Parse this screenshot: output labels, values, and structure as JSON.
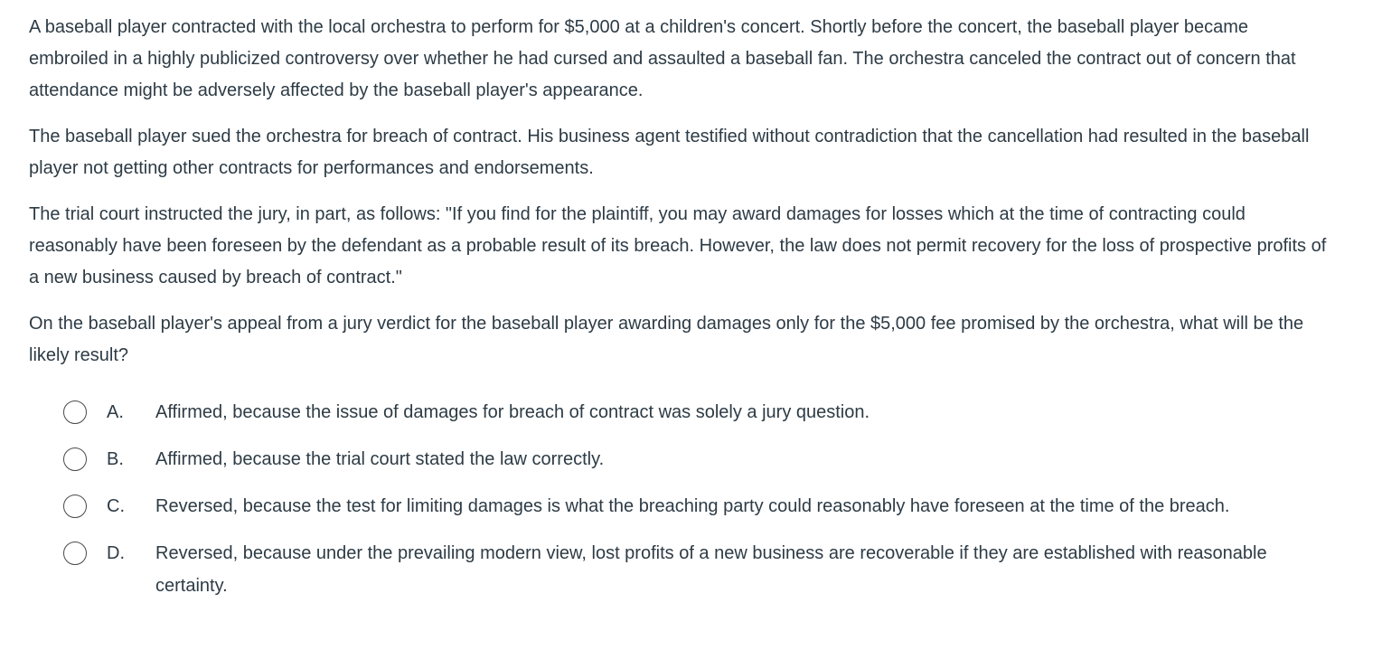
{
  "question": {
    "paragraphs": [
      "A baseball player contracted with the local orchestra to perform for $5,000 at a children's concert.  Shortly before the concert, the baseball player became embroiled in a highly publicized controversy over whether he had cursed and assaulted a baseball fan.  The orchestra canceled the contract out of concern that attendance might be adversely affected by the baseball player's appearance.",
      "The baseball player sued the orchestra for breach of contract.  His business agent testified without contradiction that the cancellation had resulted in the baseball player not getting other contracts for performances and endorsements.",
      "The trial court instructed the jury, in part, as follows: \"If you find for the plaintiff, you may award damages for losses which at the time of contracting could reasonably have been foreseen by the defendant as a probable result of its breach.  However, the law does not permit recovery for the loss of prospective profits of a new business caused by breach of contract.\"",
      "On the baseball player's appeal from a jury verdict for the baseball player awarding damages only for the $5,000 fee promised by the orchestra, what will be the likely result?"
    ]
  },
  "answers": [
    {
      "letter": "A.",
      "text": "Affirmed, because the issue of damages for breach of contract was solely a jury question."
    },
    {
      "letter": "B.",
      "text": "Affirmed, because the trial court stated the law correctly."
    },
    {
      "letter": "C.",
      "text": "Reversed, because the test for limiting damages is what the breaching party could reasonably have foreseen at the time of the breach."
    },
    {
      "letter": "D.",
      "text": "Reversed, because under the prevailing modern view, lost profits of a new business are recoverable if they are established with reasonable certainty."
    }
  ]
}
